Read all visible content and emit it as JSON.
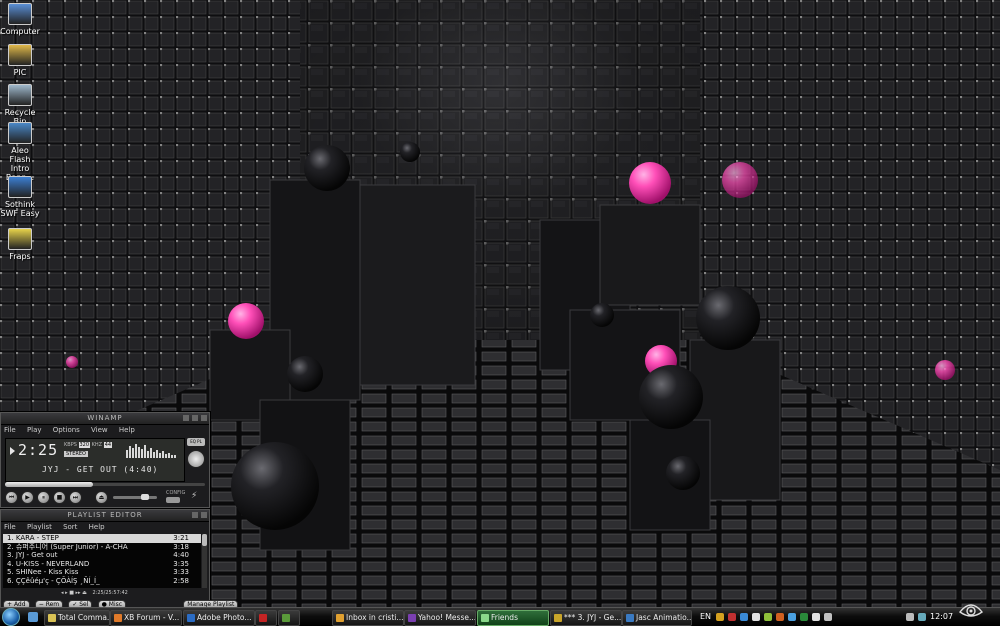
{
  "desktop": {
    "icons": [
      {
        "name": "desktop-icon-computer",
        "label": "Computer",
        "color": "#5a8fd6"
      },
      {
        "name": "desktop-icon-pic",
        "label": "PIC",
        "color": "#e0b84a"
      },
      {
        "name": "desktop-icon-recycle-bin",
        "label": "Recycle Bin",
        "color": "#9fb8cc"
      },
      {
        "name": "desktop-icon-aleo",
        "label": "Aleo Flash Intro Bann...",
        "color": "#4a88c7"
      },
      {
        "name": "desktop-icon-sothink",
        "label": "Sothink SWF Easy",
        "color": "#3c7fd2"
      },
      {
        "name": "desktop-icon-fraps",
        "label": "Fraps",
        "color": "#e7d24a"
      }
    ]
  },
  "winamp": {
    "title": "WINAMP",
    "menu": [
      "File",
      "Play",
      "Options",
      "View",
      "Help"
    ],
    "time": "2:25",
    "kbps": "320",
    "khz": "44",
    "stereo": "STEREO",
    "song": "JYJ - GET OUT (4:40)",
    "config_label": "CONFIG"
  },
  "playlist": {
    "title": "PLAYLIST EDITOR",
    "menu": [
      "File",
      "Playlist",
      "Sort",
      "Help"
    ],
    "items": [
      {
        "title": "1. KARA - STEP",
        "time": "3:21",
        "selected": true
      },
      {
        "title": "2. 슈퍼주니어 (Super Junior) - A-CHA",
        "time": "3:18",
        "selected": false
      },
      {
        "title": "3. JYJ - Get out",
        "time": "4:40",
        "selected": false
      },
      {
        "title": "4. U-KISS - NEVERLAND",
        "time": "3:35",
        "selected": false
      },
      {
        "title": "5. SHINee - Kiss Kiss",
        "time": "3:33",
        "selected": false
      },
      {
        "title": "6. ÇÇêûéµ'ç - ÇÕÀÍŞ ¸ÑÍ_Í_",
        "time": "2:58",
        "selected": false
      }
    ],
    "status": "2:25/25:57:42",
    "buttons": {
      "add": "Add",
      "rem": "Rem",
      "sel": "Sel",
      "misc": "Misc",
      "manage": "Manage Playlist"
    }
  },
  "taskbar": {
    "items": [
      {
        "name": "taskbar-total-commander",
        "label": "Total Comma...",
        "color": "#d9c255",
        "active": false
      },
      {
        "name": "taskbar-firefox-xb-forum",
        "label": "XB Forum - V...",
        "color": "#e07a2a",
        "active": false
      },
      {
        "name": "taskbar-adobe-photoshop",
        "label": "Adobe Photo...",
        "color": "#2b6cc4",
        "active": false
      },
      {
        "name": "taskbar-app-red",
        "label": "",
        "color": "#c42424",
        "active": false
      },
      {
        "name": "taskbar-app-dw",
        "label": "",
        "color": "#5a9a3a",
        "active": false
      },
      {
        "name": "taskbar-inbox",
        "label": "Inbox in cristi...",
        "color": "#e0a030",
        "active": false
      },
      {
        "name": "taskbar-yahoo-messenger",
        "label": "Yahoo! Messe...",
        "color": "#7a3fb0",
        "active": false
      },
      {
        "name": "taskbar-friends",
        "label": "Friends",
        "color": "#8ad88a",
        "active": true
      },
      {
        "name": "taskbar-winamp",
        "label": "*** 3. JYJ - Ge...",
        "color": "#c9a52a",
        "active": false
      },
      {
        "name": "taskbar-jasc-animation",
        "label": "Jasc Animatio...",
        "color": "#3a7ac2",
        "active": false
      }
    ],
    "language": "EN",
    "clock": "12:07",
    "tray_colors": [
      "#d4a020",
      "#c03030",
      "#3a8ad6",
      "#e0e0e0",
      "#8fc03a",
      "#d06020",
      "#4aa0e0",
      "#2a8a3a",
      "#e0e0e0",
      "#c0c0c0"
    ]
  }
}
